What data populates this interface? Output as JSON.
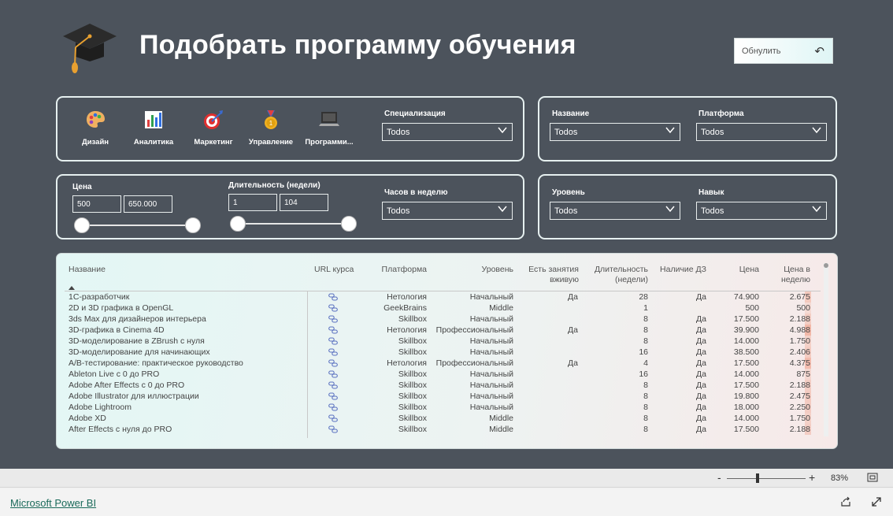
{
  "header": {
    "title": "Подобрать программу обучения",
    "reset_label": "Обнулить"
  },
  "categories": [
    {
      "label": "Дизайн",
      "icon": "palette-icon"
    },
    {
      "label": "Аналитика",
      "icon": "bar-chart-icon"
    },
    {
      "label": "Маркетинг",
      "icon": "target-icon"
    },
    {
      "label": "Управление",
      "icon": "medal-icon"
    },
    {
      "label": "Программи...",
      "icon": "laptop-icon"
    }
  ],
  "filters": {
    "specialization": {
      "label": "Специализация",
      "value": "Todos"
    },
    "name": {
      "label": "Название",
      "value": "Todos"
    },
    "platform": {
      "label": "Платформа",
      "value": "Todos"
    },
    "price": {
      "label": "Цена",
      "min": "500",
      "max": "650.000"
    },
    "duration": {
      "label": "Длительность (недели)",
      "min": "1",
      "max": "104"
    },
    "hours": {
      "label": "Часов в неделю",
      "value": "Todos"
    },
    "level": {
      "label": "Уровень",
      "value": "Todos"
    },
    "skill": {
      "label": "Навык",
      "value": "Todos"
    }
  },
  "table": {
    "columns": {
      "name": "Название",
      "url": "URL курса",
      "platform": "Платформа",
      "level": "Уровень",
      "live_1": "Есть занятия",
      "live_2": "вживую",
      "duration_1": "Длительность",
      "duration_2": "(недели)",
      "homework": "Наличие ДЗ",
      "price": "Цена",
      "weekly_1": "Цена в",
      "weekly_2": "неделю"
    },
    "rows": [
      {
        "name": "1С-разработчик",
        "platform": "Нетология",
        "level": "Начальный",
        "live": "Да",
        "duration": "28",
        "homework": "Да",
        "price": "74.900",
        "weekly": "2.675"
      },
      {
        "name": "2D и 3D графика в OpenGL",
        "platform": "GeekBrains",
        "level": "Middle",
        "live": "",
        "duration": "1",
        "homework": "",
        "price": "500",
        "weekly": "500"
      },
      {
        "name": "3ds Max для дизайнеров интерьера",
        "platform": "Skillbox",
        "level": "Начальный",
        "live": "",
        "duration": "8",
        "homework": "Да",
        "price": "17.500",
        "weekly": "2.188"
      },
      {
        "name": "3D-графика в Cinema 4D",
        "platform": "Нетология",
        "level": "Профессиональный",
        "live": "Да",
        "duration": "8",
        "homework": "Да",
        "price": "39.900",
        "weekly": "4.988"
      },
      {
        "name": "3D-моделирование в ZBrush с нуля",
        "platform": "Skillbox",
        "level": "Начальный",
        "live": "",
        "duration": "8",
        "homework": "Да",
        "price": "14.000",
        "weekly": "1.750"
      },
      {
        "name": "3D-моделирование для начинающих",
        "platform": "Skillbox",
        "level": "Начальный",
        "live": "",
        "duration": "16",
        "homework": "Да",
        "price": "38.500",
        "weekly": "2.406"
      },
      {
        "name": "A/B-тестирование: практическое руководство",
        "platform": "Нетология",
        "level": "Профессиональный",
        "live": "Да",
        "duration": "4",
        "homework": "Да",
        "price": "17.500",
        "weekly": "4.375"
      },
      {
        "name": "Ableton Live с 0 до PRO",
        "platform": "Skillbox",
        "level": "Начальный",
        "live": "",
        "duration": "16",
        "homework": "Да",
        "price": "14.000",
        "weekly": "875"
      },
      {
        "name": "Adobe After Effects с 0 до PRO",
        "platform": "Skillbox",
        "level": "Начальный",
        "live": "",
        "duration": "8",
        "homework": "Да",
        "price": "17.500",
        "weekly": "2.188"
      },
      {
        "name": "Adobe Illustrator для иллюстрации",
        "platform": "Skillbox",
        "level": "Начальный",
        "live": "",
        "duration": "8",
        "homework": "Да",
        "price": "19.800",
        "weekly": "2.475"
      },
      {
        "name": "Adobe Lightroom",
        "platform": "Skillbox",
        "level": "Начальный",
        "live": "",
        "duration": "8",
        "homework": "Да",
        "price": "18.000",
        "weekly": "2.250"
      },
      {
        "name": "Adobe XD",
        "platform": "Skillbox",
        "level": "Middle",
        "live": "",
        "duration": "8",
        "homework": "Да",
        "price": "14.000",
        "weekly": "1.750"
      },
      {
        "name": "After Effects с нуля до PRO",
        "platform": "Skillbox",
        "level": "Middle",
        "live": "",
        "duration": "8",
        "homework": "Да",
        "price": "17.500",
        "weekly": "2.188"
      }
    ]
  },
  "zoom": {
    "value": "83%"
  },
  "footer": {
    "link": "Microsoft Power BI"
  },
  "colors": {
    "canvas": "#4c535c",
    "panel_border": "#e6f0f0",
    "heat": "#f2b8a8"
  }
}
